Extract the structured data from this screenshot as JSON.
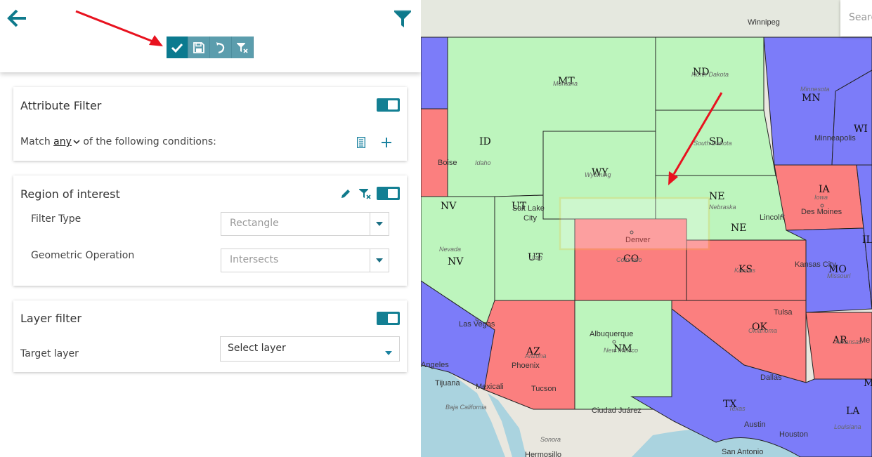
{
  "toolbar": {
    "buttons": [
      "apply-check",
      "save",
      "undo",
      "clear-filter"
    ]
  },
  "attribute_filter": {
    "title": "Attribute Filter",
    "match_prefix": "Match",
    "match_value": "any",
    "match_suffix": "of the following conditions:",
    "enabled": true
  },
  "region_of_interest": {
    "title": "Region of interest",
    "filter_type_label": "Filter Type",
    "filter_type_value": "Rectangle",
    "geometric_op_label": "Geometric Operation",
    "geometric_op_value": "Intersects",
    "enabled": true
  },
  "layer_filter": {
    "title": "Layer filter",
    "target_label": "Target layer",
    "target_value": "Select layer",
    "enabled": true
  },
  "map": {
    "search_placeholder": "Search",
    "states": {
      "MT": "MT",
      "ND": "ND",
      "MN": "MN",
      "WI": "WI",
      "ID": "ID",
      "SD": "SD",
      "WY": "WY",
      "IA": "IA",
      "NV": "NV",
      "NE": "NE",
      "UT": "UT",
      "CO": "CO",
      "KS": "KS",
      "MO": "MO",
      "IL": "IL",
      "OK": "OK",
      "AZ": "AZ",
      "NM": "NM",
      "AR": "AR",
      "TX": "TX",
      "LA": "LA",
      "MS": "M"
    },
    "cities": {
      "winnipeg": "Winnipeg",
      "minneapolis": "Minneapolis",
      "boise": "Boise",
      "salt_lake": "Salt Lake",
      "city": "City",
      "des_moines": "Des Moines",
      "lincoln": "Lincoln",
      "denver": "Denver",
      "kansas_city": "Kansas City",
      "las_vegas": "Las Vegas",
      "tulsa": "Tulsa",
      "albuquerque": "Albuquerque",
      "phoenix": "Phoenix",
      "tucson": "Tucson",
      "angeles": "Angeles",
      "tijuana": "Tijuana",
      "mexicali": "Mexicali",
      "dallas": "Dallas",
      "ciudad_juarez": "Ciudad Juárez",
      "austin": "Austin",
      "houston": "Houston",
      "san_antonio": "San Antonio",
      "hermosillo": "Hermosillo",
      "sonora": "Sonora",
      "baja": "Baja California",
      "me": "Me"
    },
    "labels_small": {
      "montana": "Montana",
      "north_dakota": "North Dakota",
      "minnesota": "Minnesota",
      "idaho": "Idaho",
      "south_dakota": "South Dakota",
      "wyoming": "Wyoming",
      "iowa": "Iowa",
      "nebraska": "Nebraska",
      "nevada": "Nevada",
      "colorado": "Colorado",
      "kansas": "Kansas",
      "missouri": "Missouri",
      "oklahoma": "Oklahoma",
      "new_mexico": "New Mexico",
      "arizona": "Arizona",
      "texas": "Texas",
      "louisiana": "Louisiana",
      "arkansas": "Arkansas",
      "utah": "Utah"
    },
    "colors": {
      "green": "#bdf5bd",
      "red": "#fb7f7f",
      "blue": "#7c7cf9",
      "roi": "#f5c03a",
      "annotation": "#e8121f"
    }
  }
}
